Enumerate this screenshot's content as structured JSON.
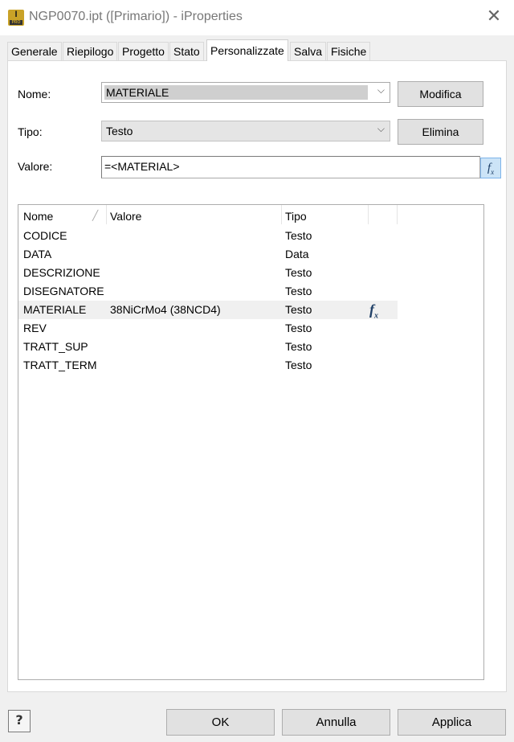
{
  "window": {
    "title": "NGP0070.ipt ([Primario]) - iProperties",
    "app_icon_letter": "I",
    "app_icon_sub": "PRO",
    "close_glyph": "✕"
  },
  "tabs": [
    {
      "label": "Generale"
    },
    {
      "label": "Riepilogo"
    },
    {
      "label": "Progetto"
    },
    {
      "label": "Stato"
    },
    {
      "label": "Personalizzate",
      "active": true
    },
    {
      "label": "Salva"
    },
    {
      "label": "Fisiche"
    }
  ],
  "form": {
    "nome_label": "Nome:",
    "nome_value": "MATERIALE",
    "tipo_label": "Tipo:",
    "tipo_value": "Testo",
    "valore_label": "Valore:",
    "valore_value": "=<MATERIAL>",
    "modifica_label": "Modifica",
    "elimina_label": "Elimina",
    "fx_label": "f",
    "fx_sub": "x"
  },
  "list": {
    "columns": [
      "Nome",
      "Valore",
      "Tipo"
    ],
    "sort_glyph": "╱",
    "rows": [
      {
        "nome": "CODICE",
        "valore": "",
        "tipo": "Testo"
      },
      {
        "nome": "DATA",
        "valore": "",
        "tipo": "Data"
      },
      {
        "nome": "DESCRIZIONE",
        "valore": "",
        "tipo": "Testo"
      },
      {
        "nome": "DISEGNATORE",
        "valore": "",
        "tipo": "Testo"
      },
      {
        "nome": "MATERIALE",
        "valore": "38NiCrMo4 (38NCD4)",
        "tipo": "Testo",
        "selected": true,
        "formula": true
      },
      {
        "nome": "REV",
        "valore": "",
        "tipo": "Testo"
      },
      {
        "nome": "TRATT_SUP",
        "valore": "",
        "tipo": "Testo"
      },
      {
        "nome": "TRATT_TERM",
        "valore": "",
        "tipo": "Testo"
      }
    ]
  },
  "footer": {
    "help_glyph": "?",
    "ok_label": "OK",
    "annulla_label": "Annulla",
    "applica_label": "Applica"
  },
  "icons": {
    "chevron": "chevron-down-icon",
    "formula": "function-icon",
    "help": "help-icon",
    "close": "close-icon"
  },
  "colors": {
    "fx_button_bg": "#cce4f7",
    "fx_button_border": "#7eb4ea",
    "app_icon": "#c9a227",
    "selected_row": "#f0f0f0"
  }
}
